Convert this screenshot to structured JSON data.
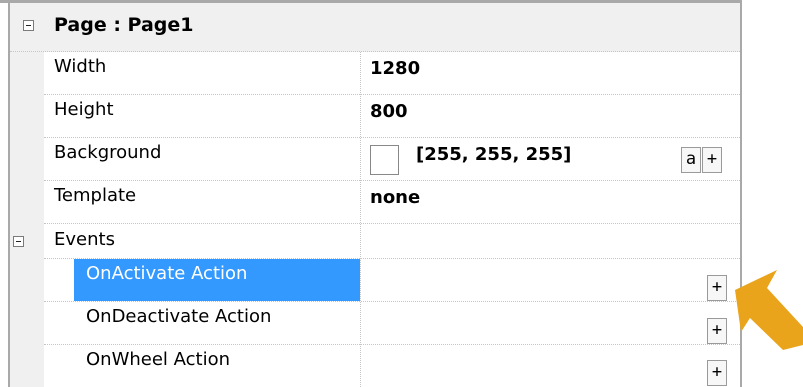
{
  "page_section": {
    "title": "Page : Page1",
    "properties": [
      {
        "name": "Width",
        "value": "1280"
      },
      {
        "name": "Height",
        "value": "800"
      },
      {
        "name": "Background",
        "value": "[255, 255, 255]"
      },
      {
        "name": "Template",
        "value": "none"
      }
    ]
  },
  "background_buttons": {
    "alpha_label": "a",
    "add_label": "+"
  },
  "events_section": {
    "title": "Events",
    "items": [
      {
        "name": "OnActivate Action",
        "button": "+"
      },
      {
        "name": "OnDeactivate Action",
        "button": "+"
      },
      {
        "name": "OnWheel Action",
        "button": "+"
      }
    ]
  },
  "colors": {
    "selection": "#3399ff",
    "annotation_arrow": "#e9a41c",
    "background_swatch": "#ffffff"
  }
}
